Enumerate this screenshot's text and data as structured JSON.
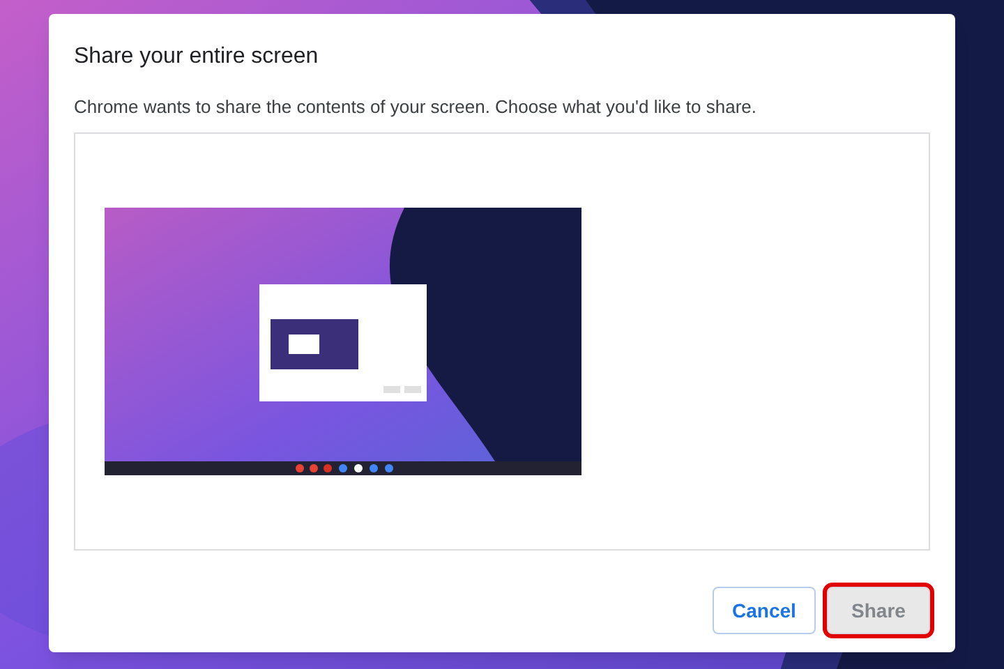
{
  "dialog": {
    "title": "Share your entire screen",
    "description": "Chrome wants to share the contents of your screen. Choose what you'd like to share.",
    "sources": [
      {
        "kind": "screen",
        "selected": false
      }
    ],
    "buttons": [
      {
        "label": "Cancel",
        "kind": "secondary",
        "disabled": false,
        "highlighted": false
      },
      {
        "label": "Share",
        "kind": "primary",
        "disabled": true,
        "highlighted": true
      }
    ]
  }
}
